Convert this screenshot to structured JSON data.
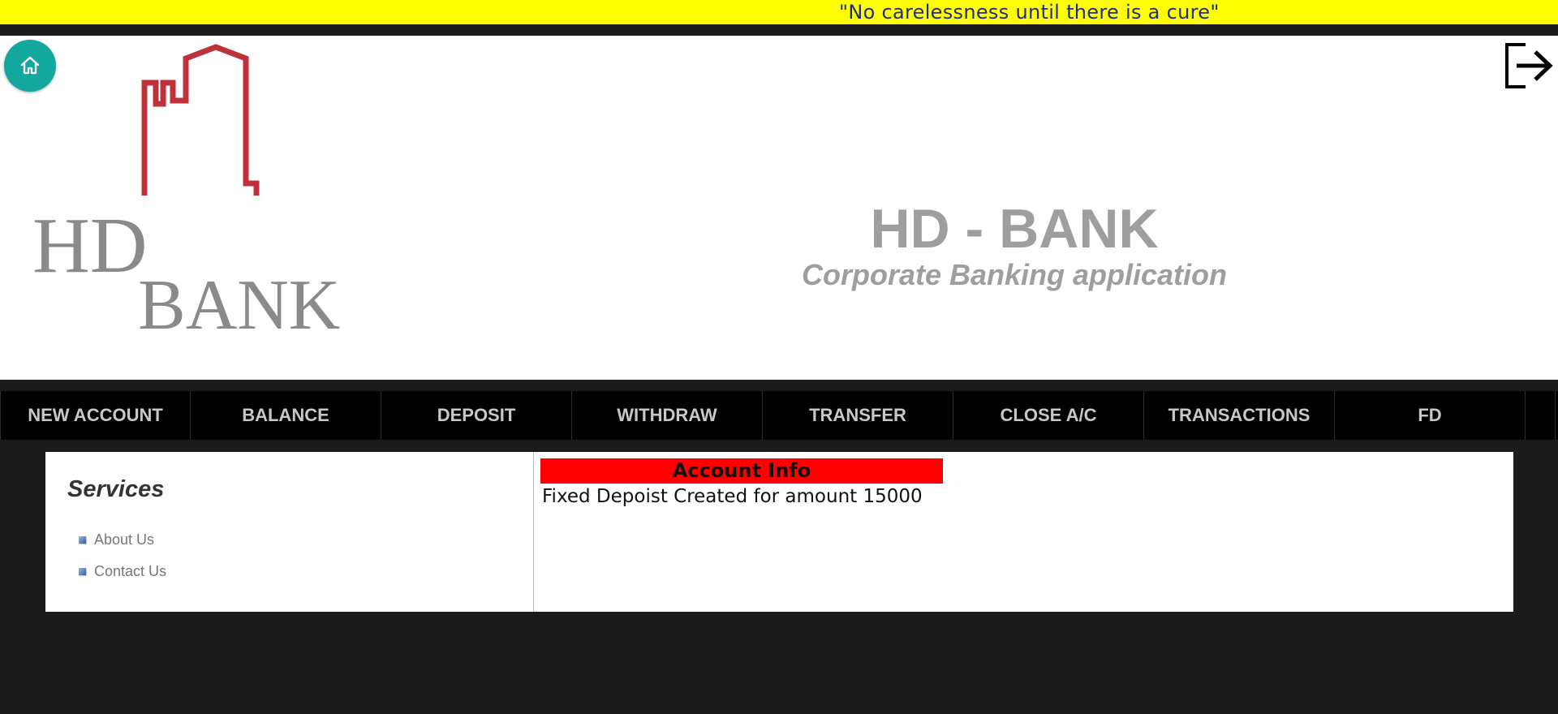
{
  "banner": {
    "text": "\"No carelessness until there is a cure\""
  },
  "header": {
    "home_icon": "home-icon",
    "logout_icon": "logout-icon",
    "logo": {
      "line1": "HD",
      "line2": "BANK"
    },
    "title": "HD - BANK",
    "subtitle": "Corporate Banking application"
  },
  "nav": {
    "items": [
      {
        "label": "NEW ACCOUNT"
      },
      {
        "label": "BALANCE"
      },
      {
        "label": "DEPOSIT"
      },
      {
        "label": "WITHDRAW"
      },
      {
        "label": "TRANSFER"
      },
      {
        "label": "CLOSE A/C"
      },
      {
        "label": "TRANSACTIONS"
      },
      {
        "label": "FD"
      }
    ]
  },
  "sidebar": {
    "heading": "Services",
    "links": [
      {
        "label": "About Us"
      },
      {
        "label": "Contact Us"
      }
    ]
  },
  "account_info": {
    "header": "Account Info",
    "message": "Fixed Depoist Created for amount 15000"
  },
  "colors": {
    "banner_bg": "#ffff00",
    "banner_text": "#1f2d8a",
    "home_button": "#13a89e",
    "logo_building": "#c0323a",
    "logo_text": "#8a8a8a",
    "title_text": "#9e9e9e",
    "info_header_bg": "#ff0000",
    "page_bg": "#1b1b1b",
    "nav_bg": "#000000"
  }
}
